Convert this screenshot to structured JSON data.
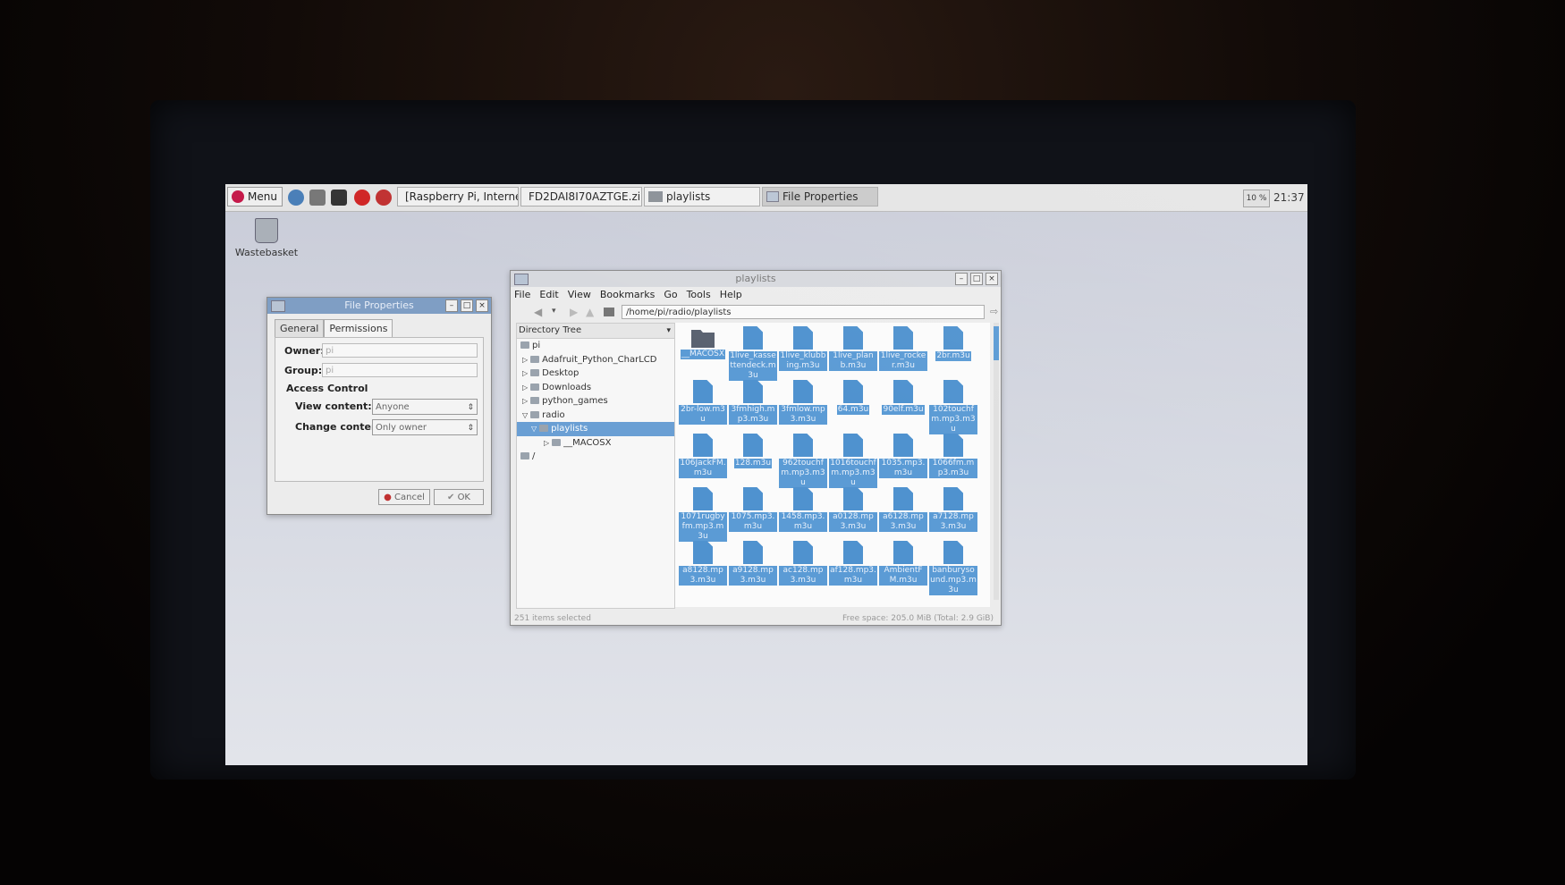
{
  "taskbar": {
    "menu_label": "Menu",
    "tasks": [
      {
        "label": "[Raspberry Pi, Interne...",
        "active": false
      },
      {
        "label": "FD2DAI8I70AZTGE.zi...",
        "active": false
      },
      {
        "label": "playlists",
        "active": false
      },
      {
        "label": "File Properties",
        "active": true
      }
    ],
    "cpu": "10 %",
    "clock": "21:37"
  },
  "desktop": {
    "wastebasket_label": "Wastebasket"
  },
  "file_properties": {
    "title": "File Properties",
    "tabs": [
      "General",
      "Permissions"
    ],
    "selected_tab": "Permissions",
    "owner_label": "Owner:",
    "owner_value": "pi",
    "group_label": "Group:",
    "group_value": "pi",
    "access_heading": "Access Control",
    "view_label": "View content:",
    "view_value": "Anyone",
    "change_label": "Change content:",
    "change_value": "Only owner",
    "cancel_label": "Cancel",
    "ok_label": "OK"
  },
  "file_manager": {
    "title": "playlists",
    "menus": [
      "File",
      "Edit",
      "View",
      "Bookmarks",
      "Go",
      "Tools",
      "Help"
    ],
    "path": "/home/pi/radio/playlists",
    "tree_header": "Directory Tree",
    "tree": [
      {
        "label": "pi",
        "depth": 0,
        "expanded": true,
        "selected": false
      },
      {
        "label": "Adafruit_Python_CharLCD",
        "depth": 1,
        "expanded": false,
        "selected": false
      },
      {
        "label": "Desktop",
        "depth": 1,
        "expanded": false,
        "selected": false
      },
      {
        "label": "Downloads",
        "depth": 1,
        "expanded": false,
        "selected": false
      },
      {
        "label": "python_games",
        "depth": 1,
        "expanded": false,
        "selected": false
      },
      {
        "label": "radio",
        "depth": 1,
        "expanded": true,
        "selected": false
      },
      {
        "label": "playlists",
        "depth": 2,
        "expanded": true,
        "selected": true
      },
      {
        "label": "__MACOSX",
        "depth": 3,
        "expanded": false,
        "selected": false
      },
      {
        "label": "/",
        "depth": 0,
        "expanded": false,
        "selected": false
      }
    ],
    "files": [
      {
        "name": "__MACOSX",
        "type": "folder"
      },
      {
        "name": "1live_kassettendeck.m3u",
        "type": "file"
      },
      {
        "name": "1live_klubbing.m3u",
        "type": "file"
      },
      {
        "name": "1live_planb.m3u",
        "type": "file"
      },
      {
        "name": "1live_rocker.m3u",
        "type": "file"
      },
      {
        "name": "2br.m3u",
        "type": "file"
      },
      {
        "name": "2br-low.m3u",
        "type": "file"
      },
      {
        "name": "3fmhigh.mp3.m3u",
        "type": "file"
      },
      {
        "name": "3fmlow.mp3.m3u",
        "type": "file"
      },
      {
        "name": "64.m3u",
        "type": "file"
      },
      {
        "name": "90elf.m3u",
        "type": "file"
      },
      {
        "name": "102touchfm.mp3.m3u",
        "type": "file"
      },
      {
        "name": "106JackFM.m3u",
        "type": "file"
      },
      {
        "name": "128.m3u",
        "type": "file"
      },
      {
        "name": "962touchfm.mp3.m3u",
        "type": "file"
      },
      {
        "name": "1016touchfm.mp3.m3u",
        "type": "file"
      },
      {
        "name": "1035.mp3.m3u",
        "type": "file"
      },
      {
        "name": "1066fm.mp3.m3u",
        "type": "file"
      },
      {
        "name": "1071rugbyfm.mp3.m3u",
        "type": "file"
      },
      {
        "name": "1075.mp3.m3u",
        "type": "file"
      },
      {
        "name": "1458.mp3.m3u",
        "type": "file"
      },
      {
        "name": "a0128.mp3.m3u",
        "type": "file"
      },
      {
        "name": "a6128.mp3.m3u",
        "type": "file"
      },
      {
        "name": "a7128.mp3.m3u",
        "type": "file"
      },
      {
        "name": "a8128.mp3.m3u",
        "type": "file"
      },
      {
        "name": "a9128.mp3.m3u",
        "type": "file"
      },
      {
        "name": "ac128.mp3.m3u",
        "type": "file"
      },
      {
        "name": "af128.mp3.m3u",
        "type": "file"
      },
      {
        "name": "AmbientFM.m3u",
        "type": "file"
      },
      {
        "name": "banburysound.mp3.m3u",
        "type": "file"
      }
    ],
    "status_left": "251 items selected",
    "status_right": "Free space: 205.0 MiB (Total: 2.9 GiB)"
  },
  "colors": {
    "selection": "#5b9bd5",
    "file_icon": "#4f92cf",
    "taskbar": "#e4e4e4"
  }
}
